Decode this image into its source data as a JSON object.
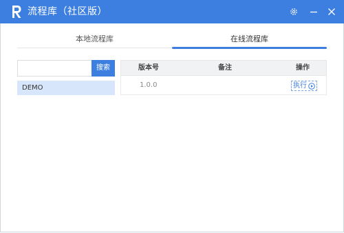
{
  "window": {
    "title": "流程库（社区版）",
    "accent_color": "#3d7fe0",
    "controls": [
      "gear-icon",
      "minimize-icon",
      "close-icon"
    ]
  },
  "tabs": [
    {
      "label": "本地流程库",
      "active": false
    },
    {
      "label": "在线流程库",
      "active": true
    }
  ],
  "search": {
    "placeholder": "",
    "value": "",
    "button_label": "搜索"
  },
  "library_list": [
    {
      "label": "DEMO",
      "selected": true
    }
  ],
  "table": {
    "columns": [
      "版本号",
      "备注",
      "操作"
    ],
    "rows": [
      {
        "version": "1.0.0",
        "note": "",
        "action_label": "执行",
        "action_icon": "play-icon"
      }
    ]
  }
}
